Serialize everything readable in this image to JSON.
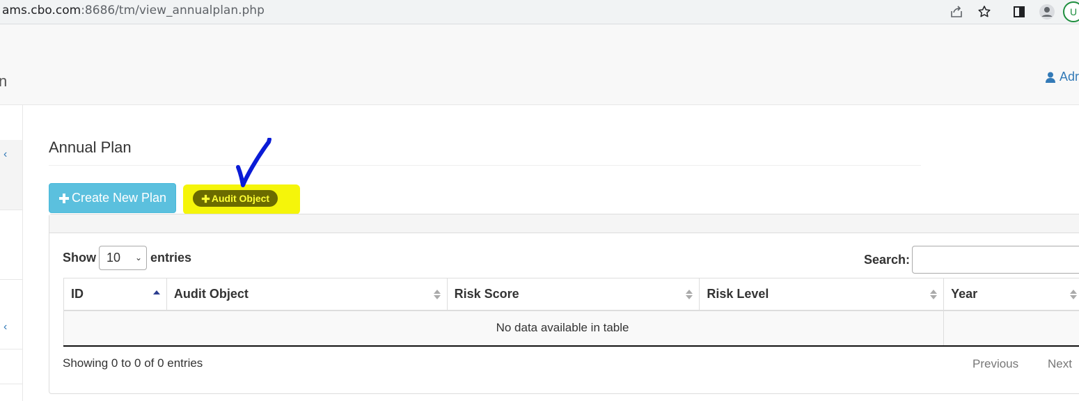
{
  "browser": {
    "url_host": "ams.cbo.com",
    "url_rest": ":8686/tm/view_annualplan.php",
    "profile_initial": "U"
  },
  "header": {
    "brand_tail": "n",
    "user_label": "Adr"
  },
  "page": {
    "title": "Annual Plan",
    "create_button": "Create New Plan",
    "audit_button": "Audit Object"
  },
  "table_controls": {
    "show_label": "Show",
    "page_length": "10",
    "entries_label": "entries",
    "search_label": "Search:"
  },
  "table": {
    "columns": [
      "ID",
      "Audit Object",
      "Risk Score",
      "Risk Level",
      "Year"
    ],
    "empty_message": "No data available in table"
  },
  "footer": {
    "info": "Showing 0 to 0 of 0 entries",
    "previous": "Previous",
    "next": "Next"
  },
  "colors": {
    "info_button": "#5bc0de",
    "highlight": "#f5f50a",
    "checkmark": "#0a1bd6",
    "link": "#337ab7"
  }
}
